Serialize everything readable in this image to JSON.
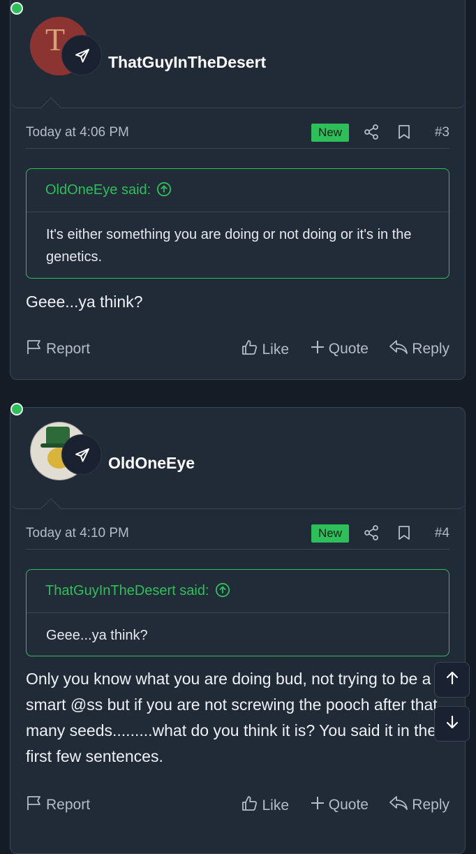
{
  "posts": [
    {
      "username": "ThatGuyInTheDesert",
      "avatar_letter": "T",
      "time": "Today at 4:06 PM",
      "new_badge": "New",
      "post_number": "#3",
      "quote": {
        "author_line": "OldOneEye said:",
        "text": "It's either something you are doing or not doing or it's in the genetics."
      },
      "body": "Geee...ya think?",
      "actions": {
        "report": "Report",
        "like": "Like",
        "quote": "Quote",
        "reply": "Reply"
      }
    },
    {
      "username": "OldOneEye",
      "time": "Today at 4:10 PM",
      "new_badge": "New",
      "post_number": "#4",
      "quote": {
        "author_line": "ThatGuyInTheDesert said:",
        "text": "Geee...ya think?"
      },
      "body": "Only you know what you are doing bud, not trying to be a smart @ss but if you are not screwing the pooch after that many seeds.........what do you think it is? You said it in the first few sentences.",
      "actions": {
        "report": "Report",
        "like": "Like",
        "quote": "Quote",
        "reply": "Reply"
      }
    }
  ],
  "icons": {
    "telegram": "telegram-icon",
    "share": "share-icon",
    "bookmark": "bookmark-icon",
    "arrow_up_circle": "arrow-up-circle-icon",
    "flag": "flag-icon",
    "thumbs_up": "thumbs-up-icon",
    "plus": "plus-icon",
    "reply": "reply-icon",
    "scroll_up": "arrow-up-icon",
    "scroll_down": "arrow-down-icon"
  },
  "colors": {
    "accent": "#2fbf5a",
    "background": "#161c26",
    "card": "#212a37",
    "border": "#3a4556",
    "muted_text": "#b4bcc8"
  }
}
